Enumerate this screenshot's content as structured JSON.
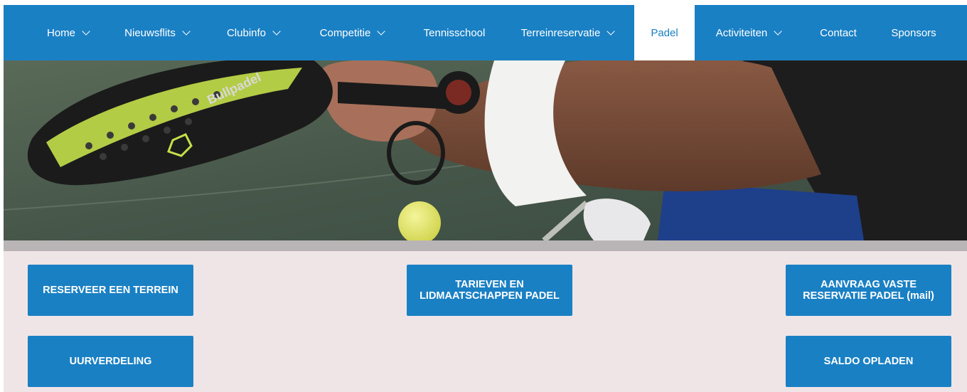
{
  "nav": {
    "items": [
      {
        "label": "Home",
        "dropdown": true
      },
      {
        "label": "Nieuwsflits",
        "dropdown": true
      },
      {
        "label": "Clubinfo",
        "dropdown": true
      },
      {
        "label": "Competitie",
        "dropdown": true
      },
      {
        "label": "Tennisschool",
        "dropdown": false
      },
      {
        "label": "Terreinreservatie",
        "dropdown": true
      },
      {
        "label": "Padel",
        "dropdown": false,
        "active": true
      },
      {
        "label": "Activiteiten",
        "dropdown": true
      },
      {
        "label": "Contact",
        "dropdown": false
      },
      {
        "label": "Sponsors",
        "dropdown": false
      }
    ],
    "accent_color": "#1a80c4"
  },
  "hero": {
    "racket_brand": "Bullpadel"
  },
  "buttons": {
    "reserveer": "RESERVEER EEN TERREIN",
    "tarieven": "TARIEVEN EN LIDMAATSCHAPPEN PADEL",
    "aanvraag": "AANVRAAG VASTE RESERVATIE PADEL (mail)",
    "uurverdeling": "UURVERDELING",
    "saldo": "SALDO OPLADEN"
  }
}
